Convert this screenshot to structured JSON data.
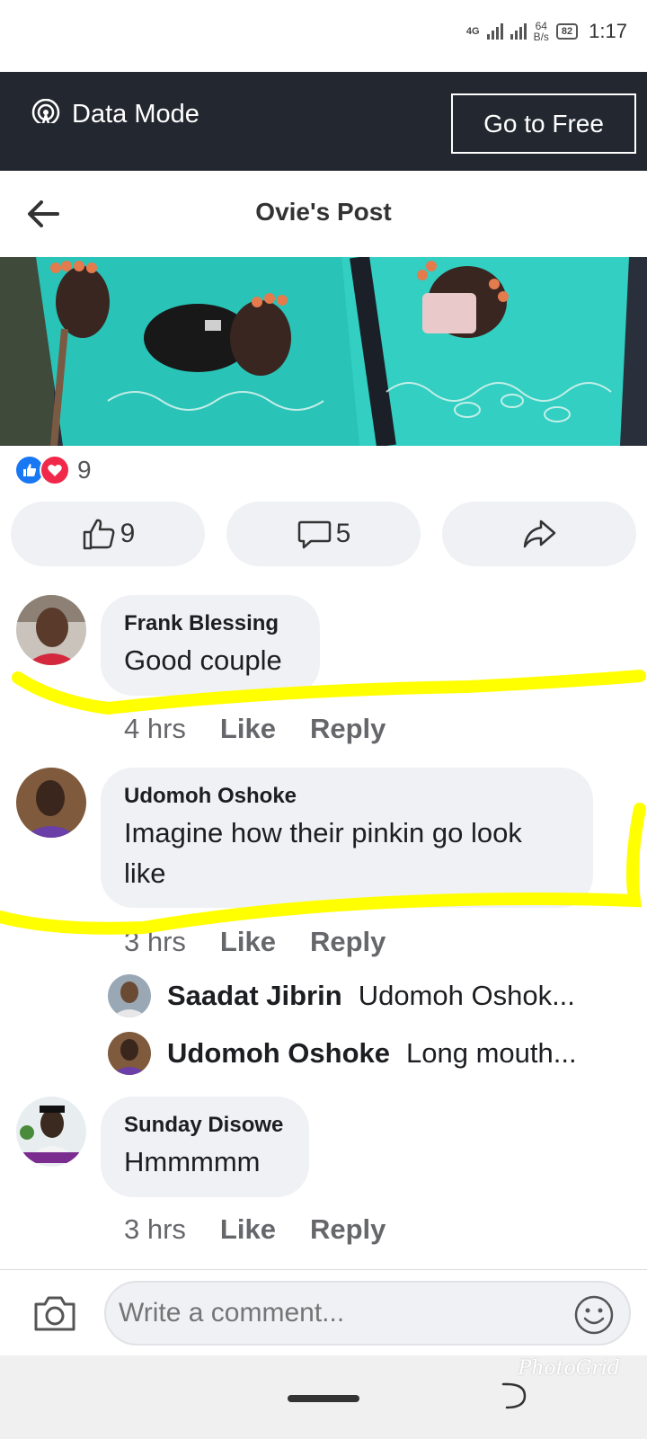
{
  "status_bar": {
    "network": "4G",
    "speed_value": "64",
    "speed_unit": "B/s",
    "battery": "82",
    "time": "1:17"
  },
  "data_mode": {
    "label": "Data Mode",
    "button": "Go to Free"
  },
  "header": {
    "title": "Ovie's Post"
  },
  "reactions": {
    "count": "9"
  },
  "actions": {
    "like_count": "9",
    "comment_count": "5"
  },
  "comments": [
    {
      "name": "Frank Blessing",
      "text": "Good couple",
      "time": "4 hrs",
      "like": "Like",
      "reply": "Reply"
    },
    {
      "name": "Udomoh Oshoke",
      "text": " Imagine how their pinkin go look like",
      "time": "3 hrs",
      "like": "Like",
      "reply": "Reply",
      "replies": [
        {
          "name": "Saadat Jibrin",
          "text": "Udomoh Oshok..."
        },
        {
          "name": "Udomoh Oshoke",
          "text": "Long mouth..."
        }
      ]
    },
    {
      "name": "Sunday Disowe",
      "text": "Hmmmmm",
      "time": "3 hrs",
      "like": "Like",
      "reply": "Reply"
    }
  ],
  "composer": {
    "placeholder": "Write a comment..."
  },
  "watermark": "PhotoGrid",
  "colors": {
    "data_bar": "#232830",
    "bubble": "#eff1f4",
    "like_blue": "#1877f2",
    "love_red": "#f02849",
    "highlight": "#ffff00"
  }
}
